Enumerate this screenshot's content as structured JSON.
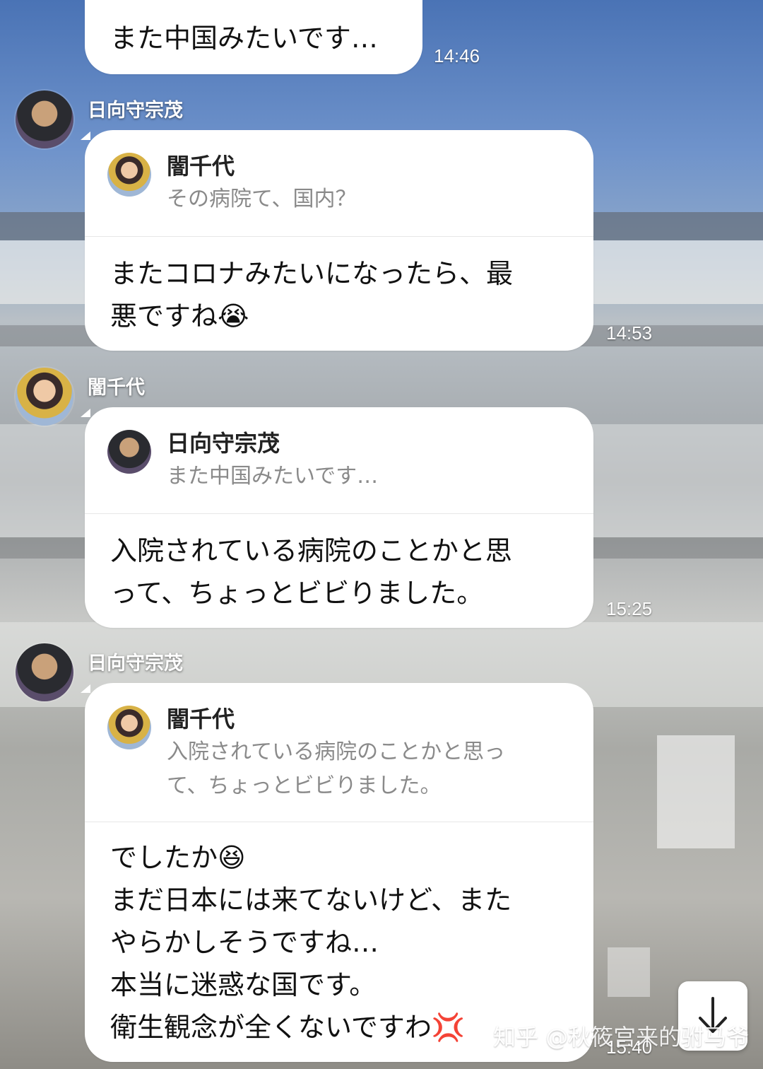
{
  "messages": [
    {
      "sender": "",
      "body": "また中国みたいです…",
      "time": "14:46"
    },
    {
      "sender": "日向守宗茂",
      "reply_to": {
        "name": "闇千代",
        "text": "その病院て、国内？"
      },
      "body": "またコロナみたいになったら、最\n悪ですね😭",
      "time": "14:53"
    },
    {
      "sender": "闇千代",
      "reply_to": {
        "name": "日向守宗茂",
        "text": "また中国みたいです…"
      },
      "body": "入院されている病院のことかと思\nって、ちょっとビビりました。",
      "time": "15:25"
    },
    {
      "sender": "日向守宗茂",
      "reply_to": {
        "name": "闇千代",
        "text": "入院されている病院のことかと思っ\nて、ちょっとビビりました。"
      },
      "body": "でしたか😆\nまだ日本には来てないけど、また\nやらかしそうですね…\n本当に迷惑な国です。\n衛生観念が全くないですわ💢",
      "time": "15:40"
    }
  ],
  "watermark": "知乎 @秋筱宫来的驸马爷",
  "icons": {
    "scroll_down": "arrow-down-icon"
  }
}
